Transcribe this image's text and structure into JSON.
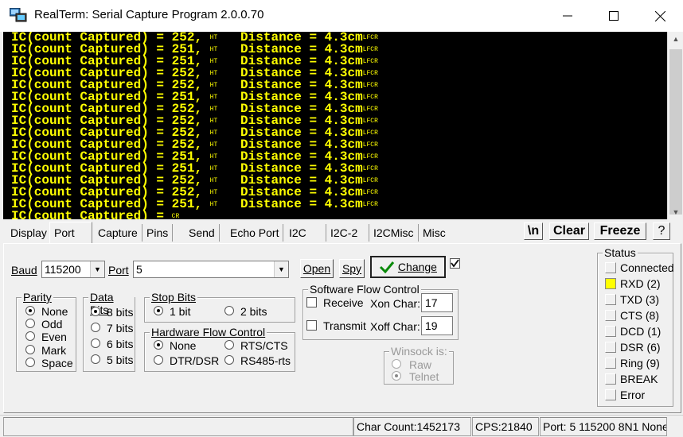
{
  "window": {
    "title": "RealTerm: Serial Capture Program 2.0.0.70"
  },
  "terminal": {
    "lines": [
      {
        "main": "IC(count Captured) = 252, ",
        "ht": "HT",
        "dist": "   Distance = 4.3cm",
        "end": "LFCR"
      },
      {
        "main": "IC(count Captured) = 251, ",
        "ht": "HT",
        "dist": "   Distance = 4.3cm",
        "end": "LFCR"
      },
      {
        "main": "IC(count Captured) = 251, ",
        "ht": "HT",
        "dist": "   Distance = 4.3cm",
        "end": "LFCR"
      },
      {
        "main": "IC(count Captured) = 252, ",
        "ht": "HT",
        "dist": "   Distance = 4.3cm",
        "end": "LFCR"
      },
      {
        "main": "IC(count Captured) = 252, ",
        "ht": "HT",
        "dist": "   Distance = 4.3cm",
        "end": "LFCR"
      },
      {
        "main": "IC(count Captured) = 251, ",
        "ht": "HT",
        "dist": "   Distance = 4.3cm",
        "end": "LFCR"
      },
      {
        "main": "IC(count Captured) = 252, ",
        "ht": "HT",
        "dist": "   Distance = 4.3cm",
        "end": "LFCR"
      },
      {
        "main": "IC(count Captured) = 252, ",
        "ht": "HT",
        "dist": "   Distance = 4.3cm",
        "end": "LFCR"
      },
      {
        "main": "IC(count Captured) = 252, ",
        "ht": "HT",
        "dist": "   Distance = 4.3cm",
        "end": "LFCR"
      },
      {
        "main": "IC(count Captured) = 252, ",
        "ht": "HT",
        "dist": "   Distance = 4.3cm",
        "end": "LFCR"
      },
      {
        "main": "IC(count Captured) = 251, ",
        "ht": "HT",
        "dist": "   Distance = 4.3cm",
        "end": "LFCR"
      },
      {
        "main": "IC(count Captured) = 251, ",
        "ht": "HT",
        "dist": "   Distance = 4.3cm",
        "end": "LFCR"
      },
      {
        "main": "IC(count Captured) = 252, ",
        "ht": "HT",
        "dist": "   Distance = 4.3cm",
        "end": "LFCR"
      },
      {
        "main": "IC(count Captured) = 252, ",
        "ht": "HT",
        "dist": "   Distance = 4.3cm",
        "end": "LFCR"
      },
      {
        "main": "IC(count Captured) = 251, ",
        "ht": "HT",
        "dist": "   Distance = 4.3cm",
        "end": "LFCR"
      },
      {
        "main": "IC(count Captured) = ",
        "ht": "",
        "dist": "",
        "end": "CR"
      }
    ]
  },
  "tabs": [
    "Display",
    "Port",
    "Capture",
    "Pins",
    "Send",
    "Echo Port",
    "I2C",
    "I2C-2",
    "I2CMisc",
    "Misc"
  ],
  "active_tab": "Port",
  "toolbar": {
    "newline": "\\n",
    "clear": "Clear",
    "freeze": "Freeze",
    "help": "?"
  },
  "port": {
    "baud_label": "Baud",
    "baud_value": "115200",
    "port_label": "Port",
    "port_value": "5",
    "open_button": "Open",
    "spy_button": "Spy",
    "change_button": "Change",
    "change_checkbox_checked": true,
    "parity": {
      "title": "Parity",
      "options": [
        "None",
        "Odd",
        "Even",
        "Mark",
        "Space"
      ],
      "selected": "None"
    },
    "data_bits": {
      "title": "Data Bits",
      "options": [
        "8 bits",
        "7 bits",
        "6 bits",
        "5 bits"
      ],
      "selected": "8 bits"
    },
    "stop_bits": {
      "title": "Stop Bits",
      "options": [
        "1 bit",
        "2 bits"
      ],
      "selected": "1 bit"
    },
    "hw_flow": {
      "title": "Hardware Flow Control",
      "options": [
        "None",
        "RTS/CTS",
        "DTR/DSR",
        "RS485-rts"
      ],
      "selected": "None"
    },
    "sw_flow": {
      "title": "Software Flow Control",
      "receive_label": "Receive",
      "xon_label": "Xon Char:",
      "xon_value": "17",
      "transmit_label": "Transmit",
      "xoff_label": "Xoff Char:",
      "xoff_value": "19"
    },
    "winsock": {
      "title": "Winsock is:",
      "options": [
        "Raw",
        "Telnet"
      ],
      "selected": "Telnet"
    }
  },
  "status": {
    "title": "Status",
    "items": [
      {
        "label": "Connected",
        "on": false
      },
      {
        "label": "RXD (2)",
        "on": true
      },
      {
        "label": "TXD (3)",
        "on": false
      },
      {
        "label": "CTS (8)",
        "on": false
      },
      {
        "label": "DCD (1)",
        "on": false
      },
      {
        "label": "DSR (6)",
        "on": false
      },
      {
        "label": "Ring (9)",
        "on": false
      },
      {
        "label": "BREAK",
        "on": false
      },
      {
        "label": "Error",
        "on": false
      }
    ],
    "led_on_color": "#ffff00"
  },
  "statusbar": {
    "char_count": "Char Count:1452173",
    "cps": "CPS:21840",
    "port_info": "Port: 5 115200 8N1 None"
  }
}
